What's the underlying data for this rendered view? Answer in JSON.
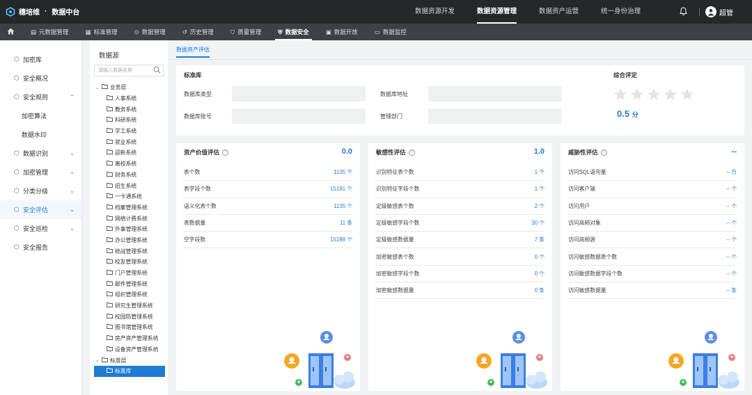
{
  "brand": {
    "name": "穗培维",
    "module": "数据中台"
  },
  "topnav": [
    {
      "label": "数据资源开发"
    },
    {
      "label": "数据资源管理",
      "active": true
    },
    {
      "label": "数据资产运营"
    },
    {
      "label": "统一身份治理"
    }
  ],
  "user": {
    "name": "超管"
  },
  "subnav": [
    {
      "label": "元数据管理",
      "icon": "database-icon"
    },
    {
      "label": "标准管理",
      "icon": "standard-icon"
    },
    {
      "label": "数据管理",
      "icon": "data-icon"
    },
    {
      "label": "历史管理",
      "icon": "history-icon"
    },
    {
      "label": "质量管理",
      "icon": "quality-icon"
    },
    {
      "label": "数据安全",
      "icon": "shield-icon",
      "active": true
    },
    {
      "label": "数据开放",
      "icon": "open-icon"
    },
    {
      "label": "数据监控",
      "icon": "monitor-icon"
    }
  ],
  "sidebar": {
    "items": [
      {
        "label": "加密库",
        "icon": "cube-icon"
      },
      {
        "label": "安全概况",
        "icon": "cube-icon"
      },
      {
        "label": "安全规则",
        "icon": "cube-icon",
        "expanded": true
      },
      {
        "label": "加密算法",
        "sub": true
      },
      {
        "label": "数据水印",
        "sub": true
      },
      {
        "label": "数据识别",
        "icon": "cube-icon",
        "collapsible": true
      },
      {
        "label": "加密管理",
        "icon": "cube-icon",
        "collapsible": true
      },
      {
        "label": "分类分级",
        "icon": "cube-icon",
        "collapsible": true
      },
      {
        "label": "安全评估",
        "icon": "cube-icon",
        "collapsible": true,
        "selected": true
      },
      {
        "label": "安全巡检",
        "icon": "cube-icon",
        "collapsible": true
      },
      {
        "label": "安全报告",
        "icon": "cube-icon"
      }
    ]
  },
  "tree": {
    "title": "数据源",
    "search_placeholder": "请输入数据名称",
    "nodes": [
      {
        "label": "业务层",
        "level": 1,
        "toggle": "expanded"
      },
      {
        "label": "人事系统",
        "level": 2
      },
      {
        "label": "教务系统",
        "level": 2
      },
      {
        "label": "科研系统",
        "level": 2
      },
      {
        "label": "学工系统",
        "level": 2
      },
      {
        "label": "就业系统",
        "level": 2
      },
      {
        "label": "迎新系统",
        "level": 2
      },
      {
        "label": "离校系统",
        "level": 2
      },
      {
        "label": "财务系统",
        "level": 2
      },
      {
        "label": "招生系统",
        "level": 2
      },
      {
        "label": "一卡通系统",
        "level": 2
      },
      {
        "label": "档案管理系统",
        "level": 2
      },
      {
        "label": "网络计费系统",
        "level": 2
      },
      {
        "label": "外事管理系统",
        "level": 2
      },
      {
        "label": "办公管理系统",
        "level": 2
      },
      {
        "label": "统战管理系统",
        "level": 2
      },
      {
        "label": "校友管理系统",
        "level": 2
      },
      {
        "label": "门户管理系统",
        "level": 2
      },
      {
        "label": "邮件管理系统",
        "level": 2
      },
      {
        "label": "组织管理系统",
        "level": 2
      },
      {
        "label": "研究生管理系统",
        "level": 2
      },
      {
        "label": "校园防管理系统",
        "level": 2
      },
      {
        "label": "图书馆管理系统",
        "level": 2
      },
      {
        "label": "房产资产管理系统",
        "level": 2
      },
      {
        "label": "设备资产管理系统",
        "level": 2
      },
      {
        "label": "标准层",
        "level": 1,
        "toggle": "expanded"
      },
      {
        "label": "标准库",
        "level": 2,
        "selected": true
      }
    ]
  },
  "main": {
    "tab": "数据资产评估",
    "info": {
      "title": "标准库",
      "fields": [
        {
          "label": "数据库类型"
        },
        {
          "label": "数据库地址"
        },
        {
          "label": "数据库账号"
        },
        {
          "label": "管理部门"
        }
      ],
      "rating_label": "综合评定",
      "rating_score": "0.5",
      "rating_unit": "分",
      "rating_stars": 0
    },
    "cards": [
      {
        "title": "资产价值评估",
        "score": "0.0",
        "rows": [
          {
            "label": "表个数",
            "value": "1135 个"
          },
          {
            "label": "表字段个数",
            "value": "15191 个"
          },
          {
            "label": "语义化表个数",
            "value": "1135 个"
          },
          {
            "label": "表数据量",
            "value": "11 条"
          },
          {
            "label": "空字段数",
            "value": "15188 个"
          }
        ]
      },
      {
        "title": "敏感性评估",
        "score": "1.0",
        "rows": [
          {
            "label": "识别特征表个数",
            "value": "1 个"
          },
          {
            "label": "识别特征字段个数",
            "value": "1 个"
          },
          {
            "label": "定级敏感表个数",
            "value": "2 个"
          },
          {
            "label": "定级敏感字段个数",
            "value": "30 个"
          },
          {
            "label": "定级敏感数据量",
            "value": "7 条"
          },
          {
            "label": "加密敏感表个数",
            "value": "0 个"
          },
          {
            "label": "加密敏感字段个数",
            "value": "0 个"
          },
          {
            "label": "加密敏感数据量",
            "value": "0 条"
          }
        ]
      },
      {
        "title": "威胁性评估",
        "score": "--",
        "rows": [
          {
            "label": "访问SQL语句量",
            "value": "-- 万"
          },
          {
            "label": "访问客户端",
            "value": "-- 个"
          },
          {
            "label": "访问用户",
            "value": "-- 个"
          },
          {
            "label": "访问高频对象",
            "value": "-- 个"
          },
          {
            "label": "访问高频源",
            "value": "-- 个"
          },
          {
            "label": "访问敏感数据表个数",
            "value": "-- 个"
          },
          {
            "label": "访问敏感数据字段个数",
            "value": "-- 个"
          },
          {
            "label": "访问敏感数据量",
            "value": "-- 条"
          }
        ]
      }
    ]
  },
  "colors": {
    "accent": "#1e7bd6",
    "topbar": "#26272b",
    "subbar": "#3e4045"
  }
}
